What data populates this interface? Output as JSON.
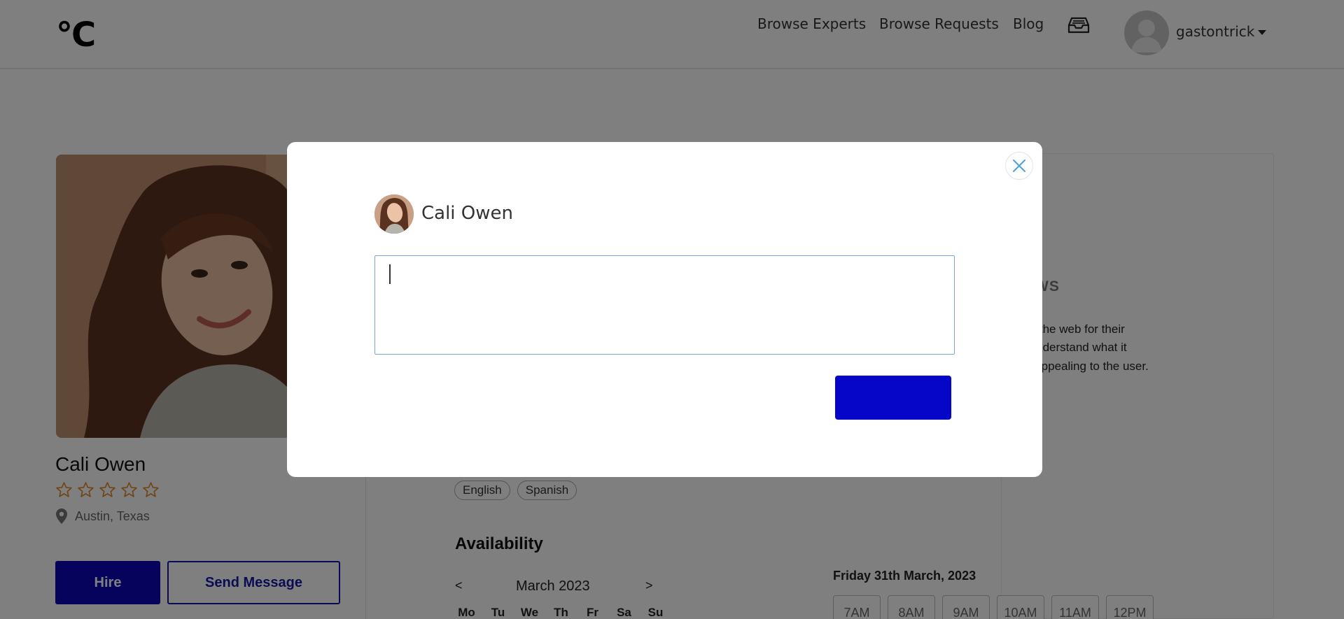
{
  "header": {
    "logo": "°C",
    "nav": {
      "browse_experts": "Browse Experts",
      "browse_requests": "Browse Requests",
      "blog": "Blog"
    },
    "inbox_icon": "inbox-tray-icon",
    "user": {
      "name": "gastontrick",
      "avatar": "default-user-avatar"
    }
  },
  "profile": {
    "name": "Cali Owen",
    "rating": 0,
    "rating_max": 5,
    "location": "Austin, Texas",
    "hire_label": "Hire",
    "message_label": "Send Message"
  },
  "content": {
    "reviews_heading_partial": "WS",
    "bio_lines": [
      "y on the web for their",
      "ey understand what it",
      "ally appealing to the user."
    ],
    "languages": [
      "English",
      "Spanish"
    ],
    "availability": {
      "title": "Availability",
      "prev": "<",
      "next": ">",
      "month": "March 2023",
      "weekdays": [
        "Mo",
        "Tu",
        "We",
        "Th",
        "Fr",
        "Sa",
        "Su"
      ],
      "selected_date": "Friday 31th March, 2023",
      "slots": [
        "7AM",
        "8AM",
        "9AM",
        "10AM",
        "11AM",
        "12PM"
      ]
    }
  },
  "modal": {
    "recipient_name": "Cali Owen",
    "message_value": "",
    "submit_label": "",
    "close_icon": "close-icon"
  },
  "colors": {
    "primary": "#0606c8",
    "hire_button": "#0a06b8",
    "star_outline": "#e08a2a",
    "textarea_border": "#6fa8dc",
    "overlay": "rgba(0,0,0,0.5)"
  }
}
